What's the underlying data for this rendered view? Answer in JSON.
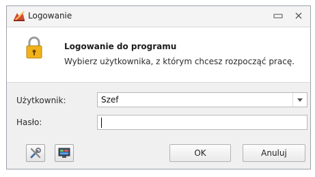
{
  "window": {
    "title": "Logowanie"
  },
  "header": {
    "title": "Logowanie do programu",
    "subtitle": "Wybierz użytkownika, z którym chcesz rozpocząć pracę."
  },
  "form": {
    "user_label": "Użytkownik:",
    "user_value": "Szef",
    "password_label": "Hasło:",
    "password_value": ""
  },
  "buttons": {
    "ok": "OK",
    "cancel": "Anuluj"
  },
  "icons": {
    "app": "app-logo-icon",
    "header": "lock-icon",
    "tools": "tools-icon",
    "monitor": "monitor-icon",
    "minimize": "minimize-icon",
    "close": "close-icon",
    "dropdown": "chevron-down-icon"
  },
  "colors": {
    "window_bg": "#f0f0f0",
    "header_bg": "#ffffff",
    "border": "#b7b7b7"
  }
}
